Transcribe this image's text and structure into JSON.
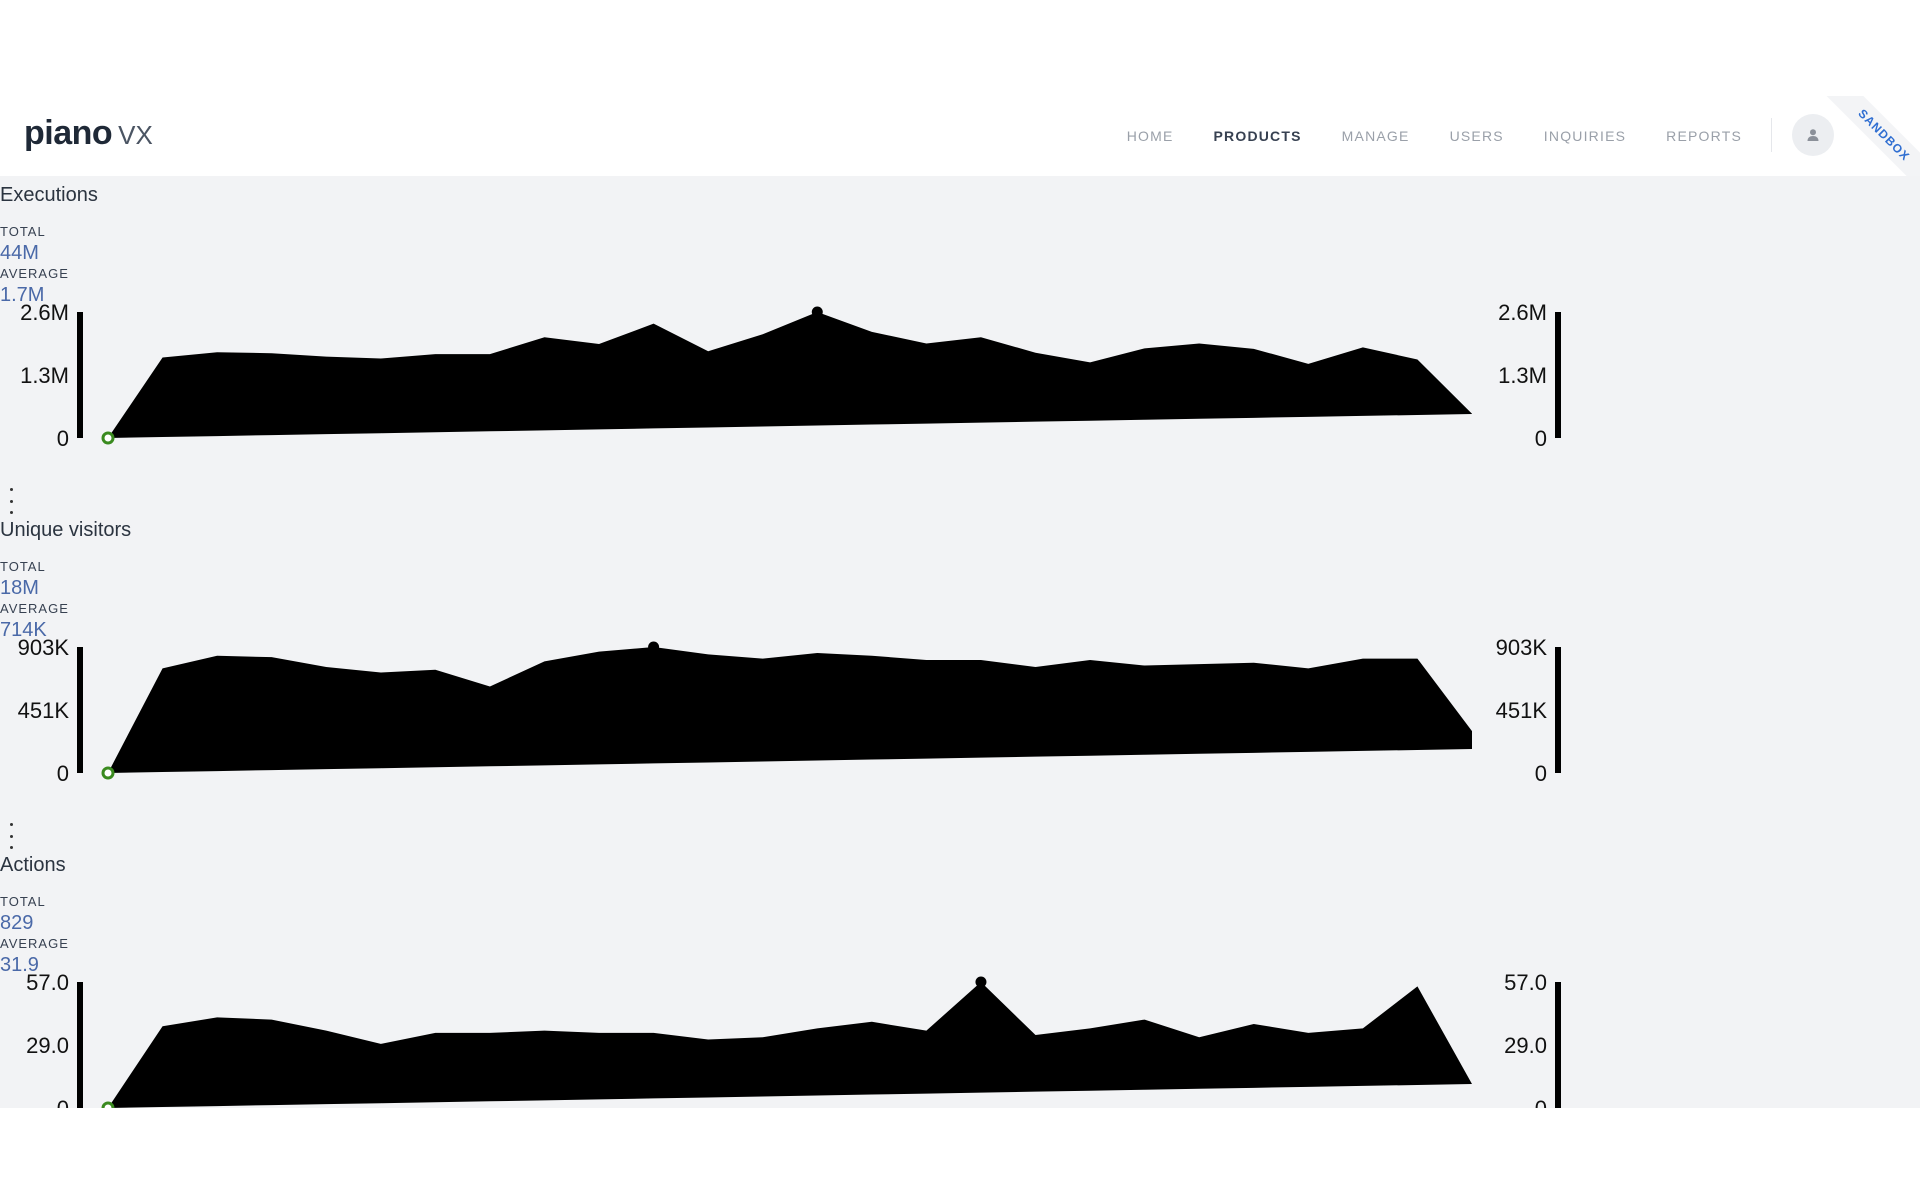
{
  "app": {
    "logo_word": "piano",
    "logo_suffix": "VX",
    "ribbon": "SANDBOX"
  },
  "nav": {
    "items": [
      {
        "label": "HOME",
        "active": false
      },
      {
        "label": "PRODUCTS",
        "active": true
      },
      {
        "label": "MANAGE",
        "active": false
      },
      {
        "label": "USERS",
        "active": false
      },
      {
        "label": "INQUIRIES",
        "active": false
      },
      {
        "label": "REPORTS",
        "active": false
      }
    ]
  },
  "labels": {
    "total": "TOTAL",
    "average": "AVERAGE"
  },
  "colors": {
    "area_fill": "#000000",
    "start_marker": "#3a8a1f",
    "stat_value": "#4a69a8",
    "content_bg": "#f2f3f5"
  },
  "chart_data": [
    {
      "type": "area",
      "title": "Executions",
      "total": "44M",
      "average": "1.7M",
      "ytick_labels": [
        "2.6M",
        "1.3M",
        "0"
      ],
      "ylim": [
        0,
        2600000
      ],
      "values": [
        0,
        1660000,
        1770000,
        1750000,
        1680000,
        1640000,
        1730000,
        1730000,
        2080000,
        1940000,
        2360000,
        1790000,
        2140000,
        2600000,
        2190000,
        1950000,
        2080000,
        1760000,
        1560000,
        1850000,
        1950000,
        1840000,
        1530000,
        1870000,
        1620000,
        500000
      ],
      "peak_index": 13
    },
    {
      "type": "area",
      "title": "Unique visitors",
      "total": "18M",
      "average": "714K",
      "ytick_labels": [
        "903K",
        "451K",
        "0"
      ],
      "ylim": [
        0,
        903000
      ],
      "values": [
        0,
        750000,
        840000,
        830000,
        760000,
        720000,
        740000,
        620000,
        800000,
        870000,
        903000,
        850000,
        820000,
        860000,
        840000,
        810000,
        810000,
        760000,
        810000,
        770000,
        780000,
        790000,
        750000,
        820000,
        820000,
        300000
      ],
      "peak_index": 10
    },
    {
      "type": "area",
      "title": "Actions",
      "total": "829",
      "average": "31.9",
      "ytick_labels": [
        "57.0",
        "29.0",
        "0"
      ],
      "ylim": [
        0,
        57
      ],
      "values": [
        0,
        37,
        41,
        40,
        35,
        29,
        34,
        34,
        35,
        34,
        34,
        31,
        32,
        36,
        39,
        35,
        57,
        33,
        36,
        40,
        32,
        38,
        34,
        36,
        55,
        3
      ],
      "peak_index": 16
    }
  ]
}
